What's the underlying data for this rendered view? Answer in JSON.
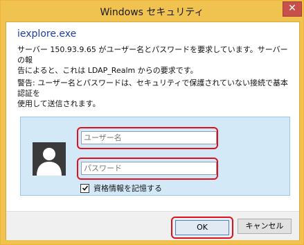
{
  "window": {
    "title": "Windows セキュリティ",
    "close_glyph": "✕",
    "title_color": "#f0c250",
    "close_color": "#c7504b"
  },
  "dialog": {
    "app_name": "iexplore.exe",
    "message_line1": "サーバー 150.93.9.65 がユーザー名とパスワードを要求しています。サーバーの報",
    "message_line2": "告によると、これは LDAP_Realm からの要求です。",
    "warning_line1": "警告: ユーザー名とパスワードは、セキュリティで保護されていない接続で基本認証を",
    "warning_line2": "使用して送信されます。"
  },
  "credentials": {
    "avatar_icon": "user-silhouette-icon",
    "username": {
      "value": "",
      "placeholder": "ユーザー名"
    },
    "password": {
      "value": "",
      "placeholder": "パスワード"
    },
    "remember": {
      "label": "資格情報を記憶する",
      "checked": true
    }
  },
  "buttons": {
    "ok_label": "OK",
    "cancel_label": "キャンセル"
  },
  "highlight_color": "#e0101c"
}
